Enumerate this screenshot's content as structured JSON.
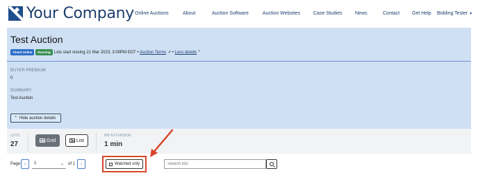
{
  "header": {
    "logo_text": "Your Company",
    "nav": [
      "Online Auctions",
      "About",
      "Auction Software",
      "Auction Websites",
      "Case Studies",
      "News",
      "Contact",
      "Get Help"
    ],
    "user_menu": "Bidding Tester"
  },
  "auction": {
    "title": "Test Auction",
    "badges": {
      "timed": "Timed Online",
      "status": "Running"
    },
    "closing_text": "Lots start closing 21 Mar 2023, 3:00PM EDT",
    "sep1": " • ",
    "terms_link": "Auction Terms",
    "sep2": " • ",
    "less_details": "Less details",
    "buyer_premium_label": "BUYER PREMIUM",
    "buyer_premium_value": "0",
    "summary_label": "SUMMARY",
    "summary_value": "Test Auction",
    "hide_details": "Hide auction details"
  },
  "stats": {
    "lots_label": "LOTS",
    "lots_value": "27",
    "grid_label": "Grid",
    "list_label": "List",
    "bid_extension_label": "BID EXTENSION",
    "bid_extension_value": "1 min"
  },
  "pager": {
    "page_label": "Page",
    "prev": "‹",
    "current": "1",
    "of_label": "of 1",
    "next": "›",
    "watched_only": "Watched only",
    "search_placeholder": "Search lots"
  },
  "colors": {
    "panel_bg": "#cfe0f5",
    "brand": "#1c3d6e",
    "highlight": "#d9442a"
  }
}
